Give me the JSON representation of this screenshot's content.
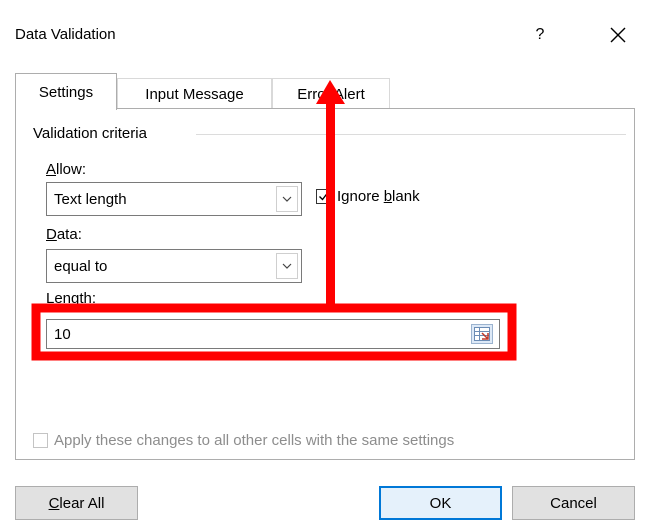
{
  "dialog": {
    "title": "Data Validation",
    "help_label": "?"
  },
  "tabs": [
    {
      "label": "Settings",
      "active": true
    },
    {
      "label": "Input Message",
      "active": false
    },
    {
      "label": "Error Alert",
      "active": false
    }
  ],
  "settings": {
    "group_label": "Validation criteria",
    "allow": {
      "label_first": "A",
      "label_rest": "llow:",
      "value": "Text length"
    },
    "ignore_blank": {
      "label_pre": "Ignore ",
      "label_u": "b",
      "label_post": "lank",
      "checked": true
    },
    "data": {
      "label_first": "D",
      "label_rest": "ata:",
      "value": "equal to"
    },
    "length": {
      "label": "Length:",
      "value": "10"
    },
    "apply_all": {
      "label": "Apply these changes to all other cells with the same settings",
      "checked": false,
      "enabled": false
    }
  },
  "buttons": {
    "clear_all_first": "C",
    "clear_all_rest": "lear All",
    "ok": "OK",
    "cancel": "Cancel"
  },
  "annotation": {
    "color": "#ff0000"
  }
}
